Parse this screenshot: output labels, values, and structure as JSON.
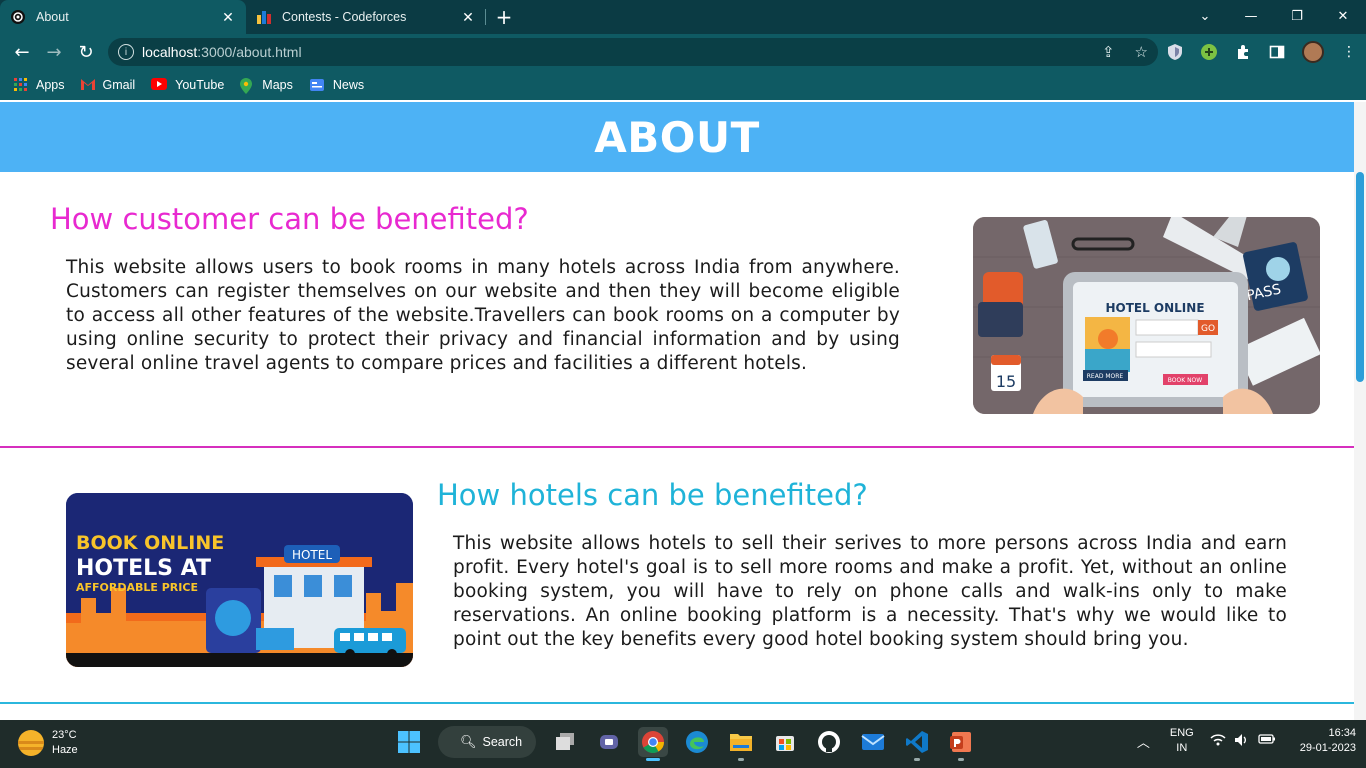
{
  "browser": {
    "tabs": [
      {
        "label": "About",
        "active": true
      },
      {
        "label": "Contests - Codeforces",
        "active": false
      }
    ],
    "new_tab": "+",
    "url_host": "localhost",
    "url_path": ":3000/about.html",
    "bookmarks": [
      "Apps",
      "Gmail",
      "YouTube",
      "Maps",
      "News"
    ]
  },
  "page": {
    "hero_title": "ABOUT",
    "section1": {
      "title": "How customer can be benefited?",
      "text": "This website allows users to book rooms in many hotels across India from anywhere. Customers can register themselves on our website and then they will become eligible to access all other features of the website.Travellers can book rooms on a computer by using online security to protect their privacy and financial information and by using several online travel agents to compare prices and facilities a different hotels.",
      "image": {
        "heading": "HOTEL ONLINE",
        "go": "GO",
        "read_more": "READ MORE",
        "book_now": "BOOK NOW",
        "pass": "PASS",
        "date": "15"
      }
    },
    "section2": {
      "title": "How hotels can be benefited?",
      "text": "This website allows hotels to sell their serives to more persons across India and earn profit. Every hotel's goal is to sell more rooms and make a profit. Yet, without an online booking system, you will have to rely on phone calls and walk-ins only to make reservations. An online booking platform is a necessity. That's why we would like to point out the key benefits every good hotel booking system should bring you.",
      "image": {
        "line1": "BOOK ONLINE",
        "line2": "HOTELS AT",
        "line3": "AFFORDABLE PRICE",
        "sign": "HOTEL"
      }
    }
  },
  "taskbar": {
    "weather_temp": "23°C",
    "weather_desc": "Haze",
    "search_label": "Search",
    "lang1": "ENG",
    "lang2": "IN",
    "time": "16:34",
    "date": "29-01-2023"
  },
  "colors": {
    "hero_bg": "#4db2f5",
    "section1_title": "#e829d0",
    "section2_title": "#1fb3d8",
    "chrome_bg": "#0f5a63"
  }
}
